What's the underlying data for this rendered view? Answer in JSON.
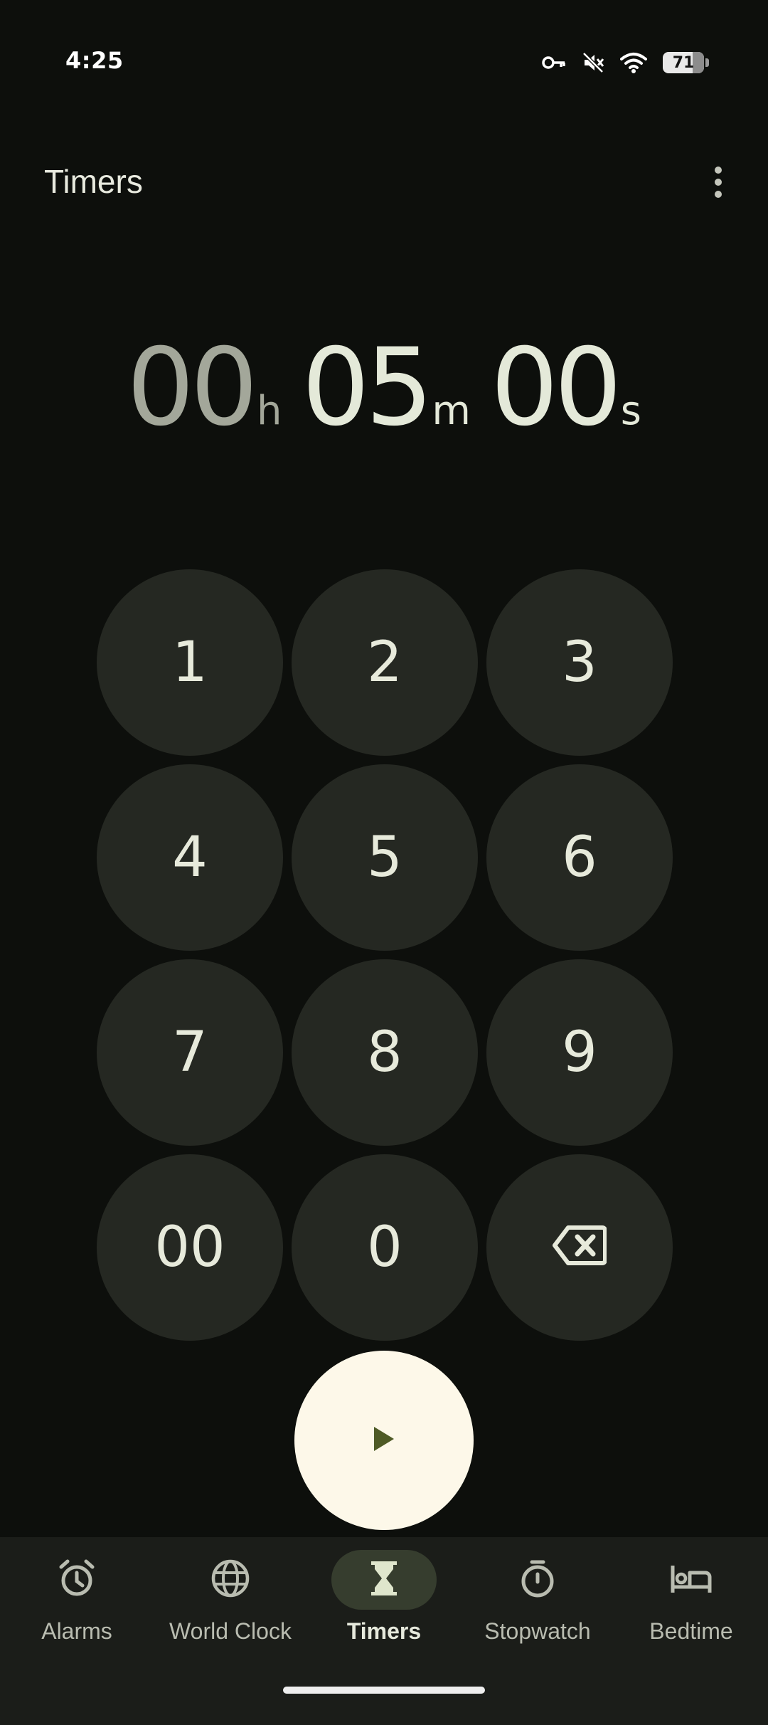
{
  "status_bar": {
    "time": "4:25",
    "battery_level": "71",
    "icons": [
      "vpn-key-icon",
      "mute-icon",
      "wifi-icon",
      "battery-icon"
    ]
  },
  "header": {
    "title": "Timers",
    "menu_icon": "more-vert-icon"
  },
  "timer": {
    "hours": "00",
    "hours_unit": "h",
    "minutes": "05",
    "minutes_unit": "m",
    "seconds": "00",
    "seconds_unit": "s"
  },
  "keypad": {
    "keys": [
      "1",
      "2",
      "3",
      "4",
      "5",
      "6",
      "7",
      "8",
      "9",
      "00",
      "0"
    ],
    "backspace_icon": "backspace-icon"
  },
  "start_button": {
    "icon": "play-icon"
  },
  "bottom_nav": {
    "items": [
      {
        "label": "Alarms",
        "icon": "alarm-icon",
        "active": false
      },
      {
        "label": "World Clock",
        "icon": "globe-icon",
        "active": false
      },
      {
        "label": "Timers",
        "icon": "hourglass-icon",
        "active": true
      },
      {
        "label": "Stopwatch",
        "icon": "stopwatch-icon",
        "active": false
      },
      {
        "label": "Bedtime",
        "icon": "bed-icon",
        "active": false
      }
    ]
  },
  "colors": {
    "background": "#0d0f0c",
    "key_background": "#252822",
    "start_button": "#fdf8e9",
    "nav_background": "#1b1d19",
    "nav_active_pill": "#363d2e",
    "play_icon": "#4e5a25"
  }
}
